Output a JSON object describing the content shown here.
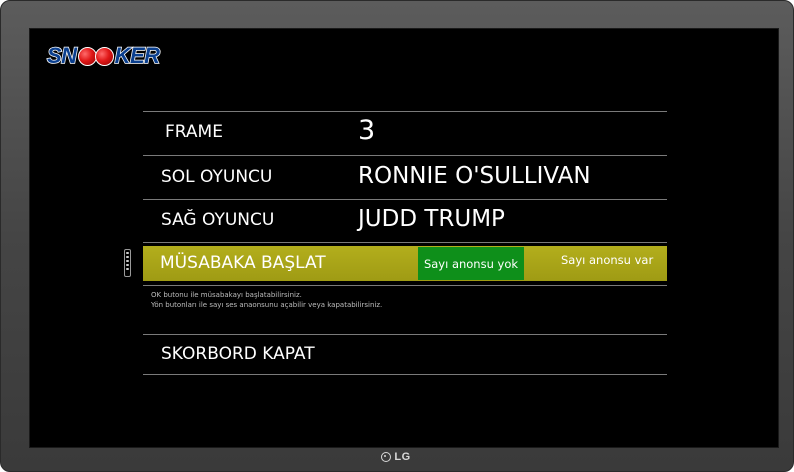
{
  "logo": {
    "text_left": "SN",
    "text_right": "KER"
  },
  "menu": {
    "frame": {
      "label": "FRAME",
      "value": "3"
    },
    "left_player": {
      "label": "SOL OYUNCU",
      "value": "RONNIE O'SULLIVAN"
    },
    "right_player": {
      "label": "SAĞ OYUNCU",
      "value": "JUDD TRUMP"
    },
    "start_match": {
      "label": "MÜSABAKA BAŞLAT",
      "options": [
        "Sayı anonsu yok",
        "Sayı anonsu var"
      ],
      "selected_option": "Sayı anonsu yok"
    },
    "hint_lines": [
      "OK butonu ile müsabakayı başlatabilirsiniz.",
      "Yön butonları ile sayı ses anaonsunu açabilir veya kapatabilirsiniz."
    ],
    "close_scoreboard": {
      "label": "SKORBORD KAPAT"
    }
  },
  "tv": {
    "brand": "LG"
  },
  "colors": {
    "screen_bg": "#000000",
    "highlight_bg": "#a9a418",
    "selected_option_bg": "#0e8f1a",
    "logo_text": "#0b3f8e",
    "logo_balls": "#e01818",
    "divider": "#7a7a7a"
  },
  "icons": {
    "remote": "remote-control-icon",
    "tv_logo": "lg-logo-icon"
  }
}
